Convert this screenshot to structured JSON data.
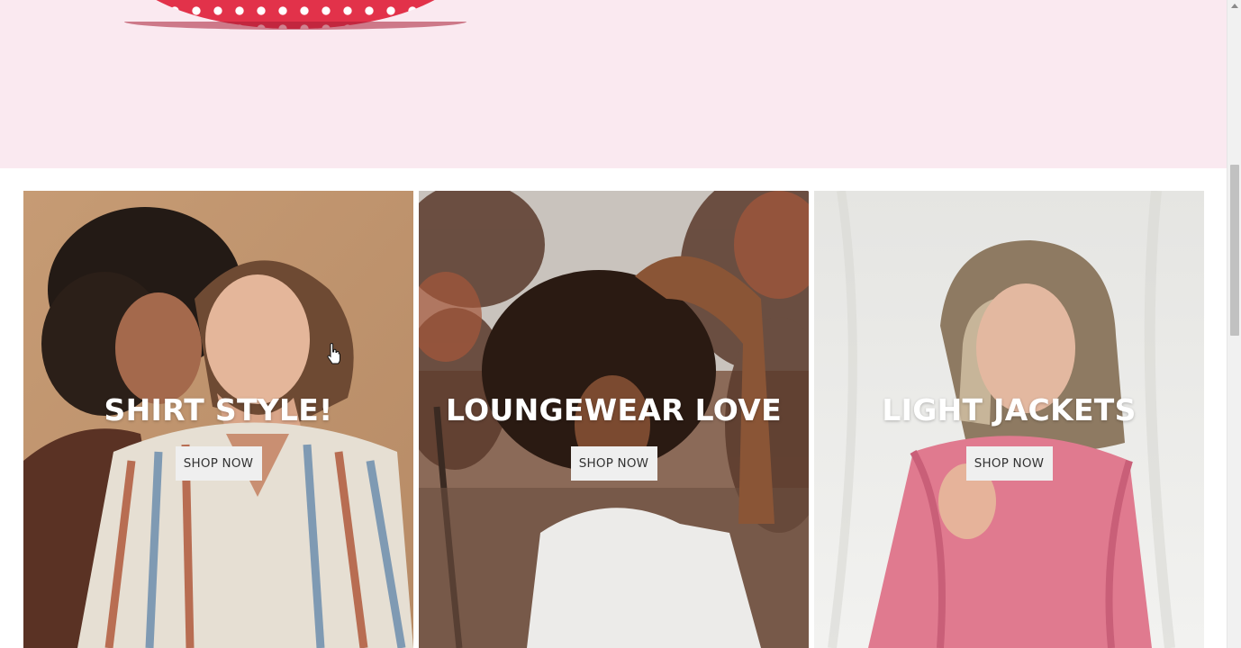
{
  "hero": {
    "colors": {
      "background": "#fae9f0",
      "accent_red": "#e2324a"
    }
  },
  "categories": [
    {
      "title": "SHIRT STYLE!",
      "button_label": "SHOP NOW"
    },
    {
      "title": "LOUNGEWEAR LOVE",
      "button_label": "SHOP NOW"
    },
    {
      "title": "LIGHT JACKETS",
      "button_label": "SHOP NOW"
    }
  ],
  "icons": {
    "cursor": "hand-pointer-icon",
    "scroll_up": "chevron-up-icon"
  },
  "colors": {
    "page_background": "#ffffff",
    "button_background": "#efefef",
    "button_text": "#333333",
    "title_text": "#ffffff"
  }
}
